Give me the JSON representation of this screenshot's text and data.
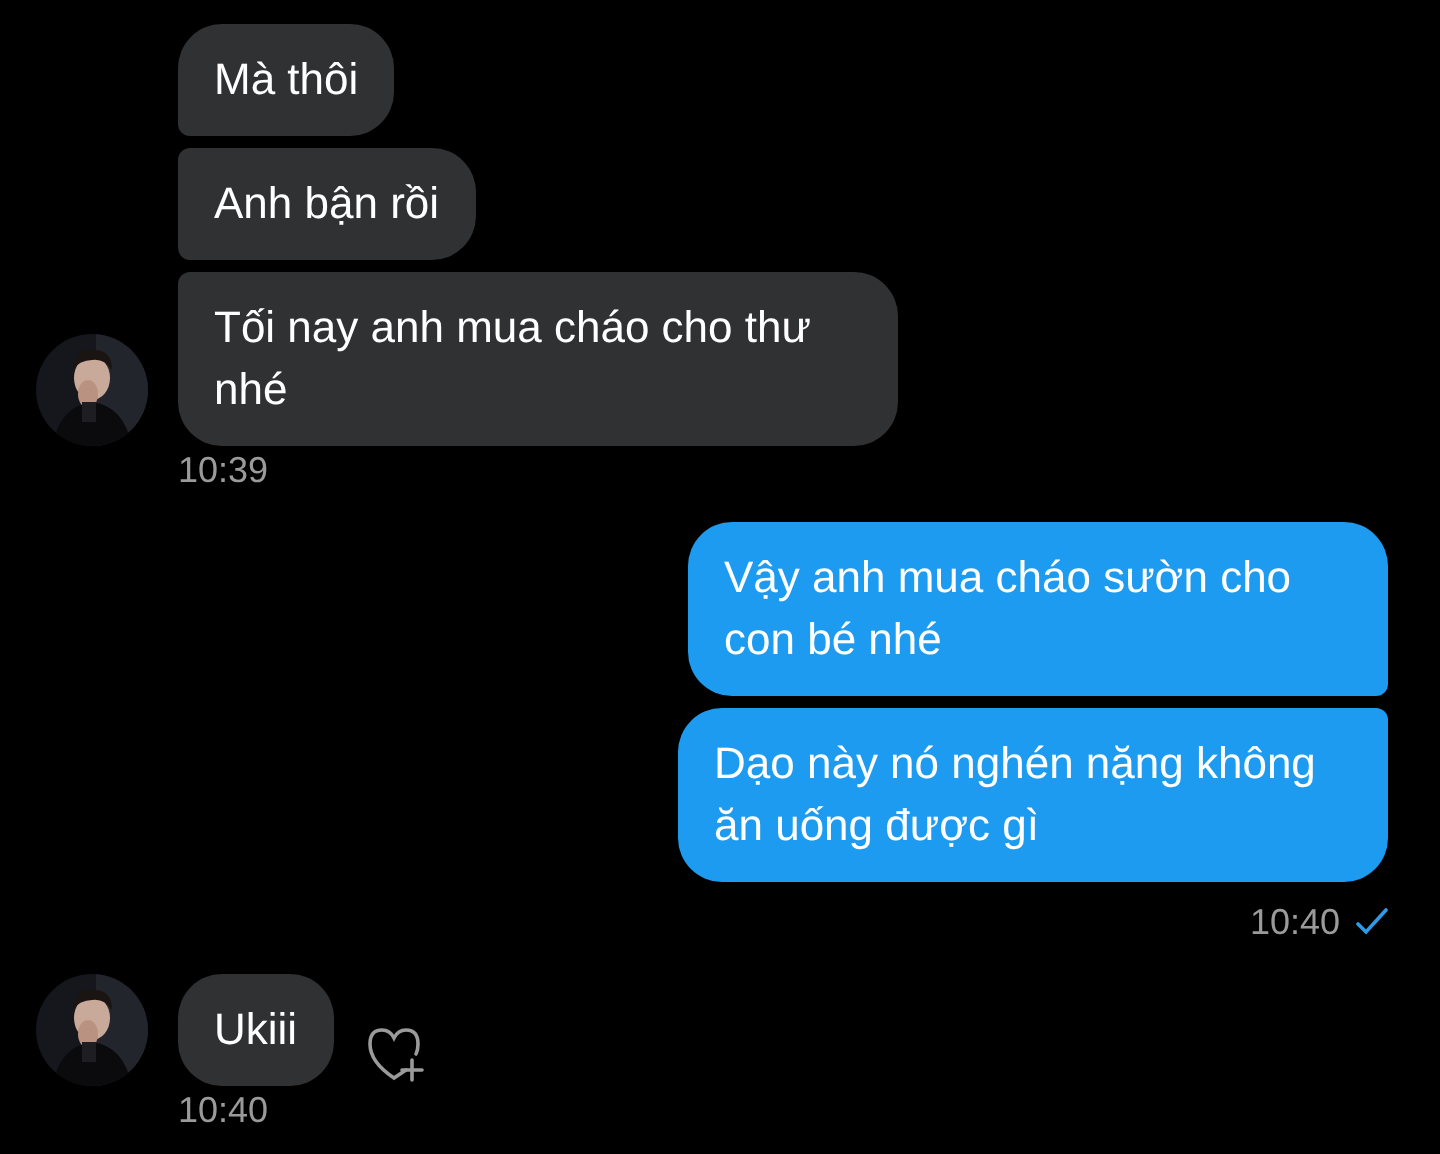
{
  "messages": [
    {
      "kind": "received",
      "bubbles": [
        "Mà thôi",
        "Anh bận rồi",
        "Tối nay anh mua cháo cho thư nhé"
      ],
      "time": "10:39"
    },
    {
      "kind": "sent",
      "bubbles": [
        "Vậy anh mua cháo sườn cho con bé nhé",
        "Dạo này nó nghén nặng không ăn uống được gì"
      ],
      "time": "10:40",
      "read": true
    },
    {
      "kind": "received",
      "bubbles": [
        "Ukiii"
      ],
      "time": "10:40",
      "reaction_button": true
    }
  ]
}
